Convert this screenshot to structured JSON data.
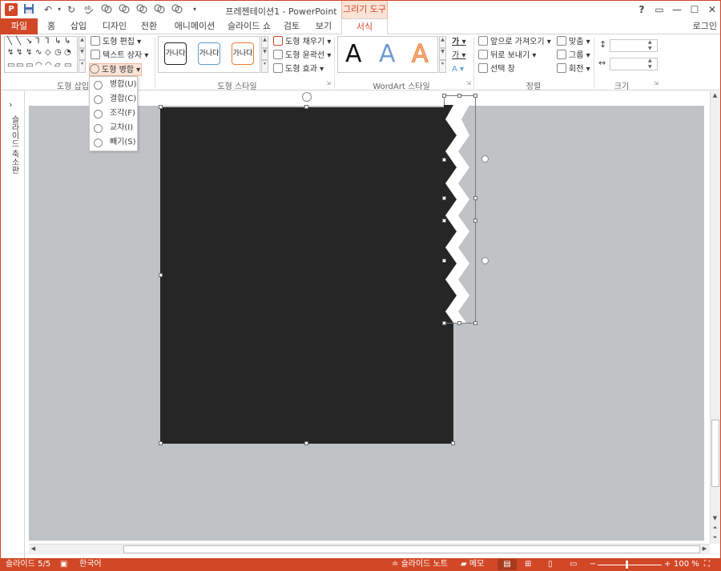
{
  "titlebar": {
    "app_icon": "P",
    "title": "프레젠테이션1 - PowerPoint",
    "context_tab": "그리기 도구",
    "help": "?",
    "ribbon_display": "▭",
    "minimize": "—",
    "maximize": "☐",
    "close": "✕",
    "quick_access": [
      "save-icon",
      "undo-icon",
      "redo-icon",
      "spellcheck-icon",
      "merge-union-icon",
      "merge-combine-icon",
      "merge-fragment-icon",
      "merge-intersect-icon",
      "merge-subtract-icon",
      "merge-shape-icon",
      "customize-icon"
    ]
  },
  "tabs": [
    "파일",
    "홈",
    "삽입",
    "디자인",
    "전환",
    "애니메이션",
    "슬라이드 쇼",
    "검토",
    "보기",
    "서식"
  ],
  "login": "로그인",
  "ribbon": {
    "insert_shapes": {
      "label": "도형 삽입",
      "edit_shape": "도형 편집",
      "text_box": "텍스트 상자",
      "merge_shapes": "도형 병합"
    },
    "shape_styles": {
      "label": "도형 스타일",
      "preset_text": "가나다",
      "fill": "도형 채우기",
      "outline": "도형 윤곽선",
      "effects": "도형 효과"
    },
    "wordart": {
      "label": "WordArt 스타일",
      "letter": "A",
      "text_fill_glyph": "가",
      "text_outline_glyph": "가"
    },
    "arrange": {
      "label": "정렬",
      "bring_forward": "앞으로 가져오기",
      "send_backward": "뒤로 보내기",
      "selection_pane": "선택 창",
      "align": "맞춤",
      "group": "그룹",
      "rotate": "회전"
    },
    "size": {
      "label": "크기",
      "height_value": "",
      "width_value": ""
    }
  },
  "merge_menu": [
    {
      "label": "병합(U)",
      "icon": "union-icon"
    },
    {
      "label": "결합(C)",
      "icon": "combine-icon"
    },
    {
      "label": "조각(F)",
      "icon": "fragment-icon"
    },
    {
      "label": "교차(I)",
      "icon": "intersect-icon"
    },
    {
      "label": "빼기(S)",
      "icon": "subtract-icon"
    }
  ],
  "left_pane": {
    "collapse": "›",
    "label": "슬라이드 축소판"
  },
  "status": {
    "slide": "슬라이드 5/5",
    "language": "한국어",
    "notes": "슬라이드 노트",
    "comments": "메모",
    "zoom": "100 %",
    "zoom_out": "−",
    "zoom_in": "+"
  },
  "colors": {
    "accent": "#d24726",
    "shape_fill": "#262626",
    "slide_bg": "#bfc3c6"
  }
}
